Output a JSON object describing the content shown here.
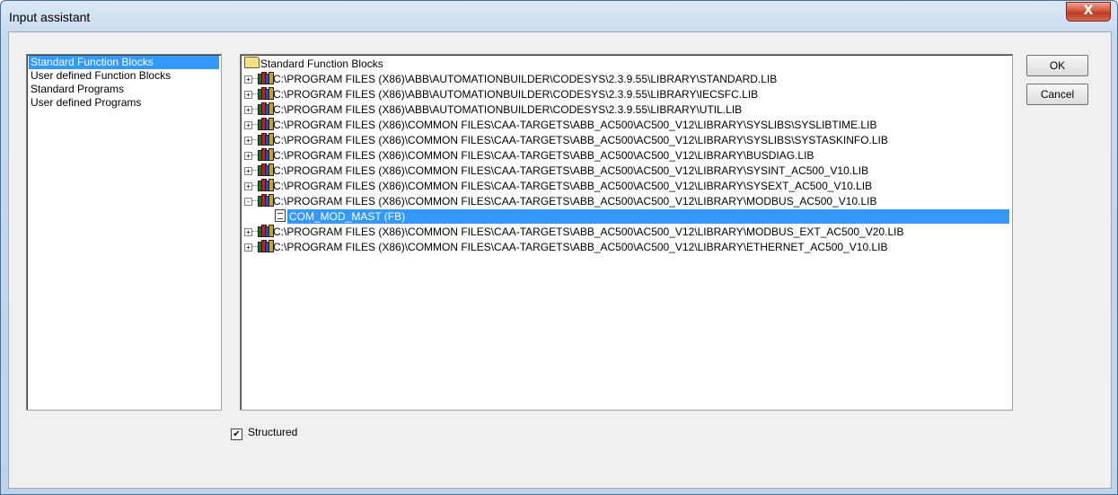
{
  "window": {
    "title": "Input assistant",
    "close_label": "X"
  },
  "categories": [
    {
      "label": "Standard Function Blocks",
      "selected": true
    },
    {
      "label": "User defined Function Blocks",
      "selected": false
    },
    {
      "label": "Standard Programs",
      "selected": false
    },
    {
      "label": "User defined Programs",
      "selected": false
    }
  ],
  "tree": {
    "root_label": "Standard Function Blocks",
    "libraries": [
      {
        "label": "C:\\PROGRAM FILES (X86)\\ABB\\AUTOMATIONBUILDER\\CODESYS\\2.3.9.55\\LIBRARY\\STANDARD.LIB",
        "expander": "+"
      },
      {
        "label": "C:\\PROGRAM FILES (X86)\\ABB\\AUTOMATIONBUILDER\\CODESYS\\2.3.9.55\\LIBRARY\\IECSFC.LIB",
        "expander": "+"
      },
      {
        "label": "C:\\PROGRAM FILES (X86)\\ABB\\AUTOMATIONBUILDER\\CODESYS\\2.3.9.55\\LIBRARY\\UTIL.LIB",
        "expander": "+"
      },
      {
        "label": "C:\\PROGRAM FILES (X86)\\COMMON FILES\\CAA-TARGETS\\ABB_AC500\\AC500_V12\\LIBRARY\\SYSLIBS\\SYSLIBTIME.LIB",
        "expander": "+"
      },
      {
        "label": "C:\\PROGRAM FILES (X86)\\COMMON FILES\\CAA-TARGETS\\ABB_AC500\\AC500_V12\\LIBRARY\\SYSLIBS\\SYSTASKINFO.LIB",
        "expander": "+"
      },
      {
        "label": "C:\\PROGRAM FILES (X86)\\COMMON FILES\\CAA-TARGETS\\ABB_AC500\\AC500_V12\\LIBRARY\\BUSDIAG.LIB",
        "expander": "+"
      },
      {
        "label": "C:\\PROGRAM FILES (X86)\\COMMON FILES\\CAA-TARGETS\\ABB_AC500\\AC500_V12\\LIBRARY\\SYSINT_AC500_V10.LIB",
        "expander": "+"
      },
      {
        "label": "C:\\PROGRAM FILES (X86)\\COMMON FILES\\CAA-TARGETS\\ABB_AC500\\AC500_V12\\LIBRARY\\SYSEXT_AC500_V10.LIB",
        "expander": "+"
      },
      {
        "label": "C:\\PROGRAM FILES (X86)\\COMMON FILES\\CAA-TARGETS\\ABB_AC500\\AC500_V12\\LIBRARY\\MODBUS_AC500_V10.LIB",
        "expander": "-"
      },
      {
        "label": "C:\\PROGRAM FILES (X86)\\COMMON FILES\\CAA-TARGETS\\ABB_AC500\\AC500_V12\\LIBRARY\\MODBUS_EXT_AC500_V20.LIB",
        "expander": "+"
      },
      {
        "label": "C:\\PROGRAM FILES (X86)\\COMMON FILES\\CAA-TARGETS\\ABB_AC500\\AC500_V12\\LIBRARY\\ETHERNET_AC500_V10.LIB",
        "expander": "+"
      }
    ],
    "expanded_child": {
      "label": "COM_MOD_MAST (FB)",
      "selected": true
    }
  },
  "buttons": {
    "ok_label": "OK",
    "cancel_label": "Cancel"
  },
  "structured": {
    "label": "Structured",
    "checked": true,
    "check_glyph": "✔"
  },
  "colors": {
    "selection": "#3399ff",
    "close_button": "#c8452a"
  }
}
